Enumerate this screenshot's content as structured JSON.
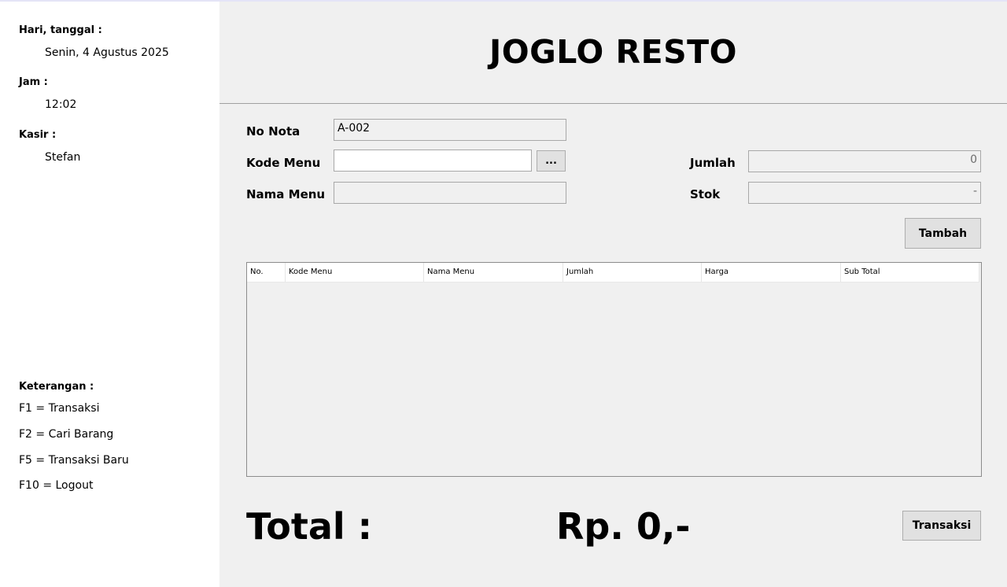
{
  "sidebar": {
    "date_label": "Hari, tanggal :",
    "date_value": "Senin, 4 Agustus 2025",
    "time_label": "Jam :",
    "time_value": "12:02",
    "cashier_label": "Kasir :",
    "cashier_value": "Stefan",
    "legend_title": "Keterangan :",
    "legend_items": [
      "F1 = Transaksi",
      "F2 = Cari Barang",
      "F5 = Transaksi Baru",
      "F10 = Logout"
    ]
  },
  "header": {
    "title": "JOGLO RESTO"
  },
  "form": {
    "no_nota_label": "No Nota",
    "no_nota_value": "A-002",
    "kode_menu_label": "Kode Menu",
    "kode_menu_value": "",
    "browse_label": "...",
    "nama_menu_label": "Nama Menu",
    "nama_menu_value": "",
    "jumlah_label": "Jumlah",
    "jumlah_value": "0",
    "stok_label": "Stok",
    "stok_value": "-",
    "add_button": "Tambah"
  },
  "table": {
    "columns": [
      "No.",
      "Kode Menu",
      "Nama Menu",
      "Jumlah",
      "Harga",
      "Sub Total"
    ],
    "rows": []
  },
  "footer": {
    "total_label": "Total :",
    "total_value": "Rp. 0,-",
    "transaction_button": "Transaksi"
  }
}
